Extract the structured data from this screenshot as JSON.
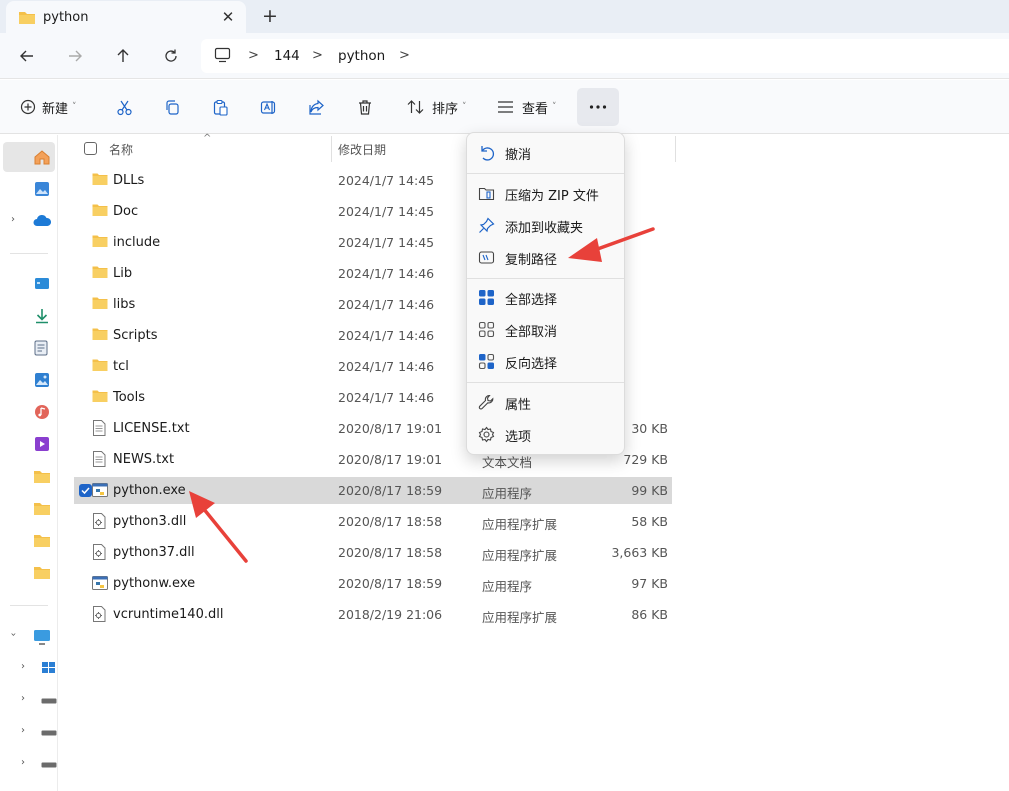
{
  "tab": {
    "title": "python"
  },
  "breadcrumb": [
    "144",
    "python"
  ],
  "toolbar": {
    "new_label": "新建",
    "sort_label": "排序",
    "view_label": "查看"
  },
  "columns": {
    "name": "名称",
    "modified": "修改日期"
  },
  "files": [
    {
      "name": "DLLs",
      "modified": "2024/1/7 14:45",
      "type": "",
      "size": "",
      "icon": "folder-icon",
      "selected": false
    },
    {
      "name": "Doc",
      "modified": "2024/1/7 14:45",
      "type": "",
      "size": "",
      "icon": "folder-icon",
      "selected": false
    },
    {
      "name": "include",
      "modified": "2024/1/7 14:45",
      "type": "",
      "size": "",
      "icon": "folder-icon",
      "selected": false
    },
    {
      "name": "Lib",
      "modified": "2024/1/7 14:46",
      "type": "",
      "size": "",
      "icon": "folder-icon",
      "selected": false
    },
    {
      "name": "libs",
      "modified": "2024/1/7 14:46",
      "type": "",
      "size": "",
      "icon": "folder-icon",
      "selected": false
    },
    {
      "name": "Scripts",
      "modified": "2024/1/7 14:46",
      "type": "",
      "size": "",
      "icon": "folder-icon",
      "selected": false
    },
    {
      "name": "tcl",
      "modified": "2024/1/7 14:46",
      "type": "",
      "size": "",
      "icon": "folder-icon",
      "selected": false
    },
    {
      "name": "Tools",
      "modified": "2024/1/7 14:46",
      "type": "",
      "size": "",
      "icon": "folder-icon",
      "selected": false
    },
    {
      "name": "LICENSE.txt",
      "modified": "2020/8/17 19:01",
      "type": "",
      "size": "30 KB",
      "icon": "text-file-icon",
      "selected": false
    },
    {
      "name": "NEWS.txt",
      "modified": "2020/8/17 19:01",
      "type": "文本文档",
      "size": "729 KB",
      "icon": "text-file-icon",
      "selected": false
    },
    {
      "name": "python.exe",
      "modified": "2020/8/17 18:59",
      "type": "应用程序",
      "size": "99 KB",
      "icon": "python-exe-icon",
      "selected": true
    },
    {
      "name": "python3.dll",
      "modified": "2020/8/17 18:58",
      "type": "应用程序扩展",
      "size": "58 KB",
      "icon": "dll-file-icon",
      "selected": false
    },
    {
      "name": "python37.dll",
      "modified": "2020/8/17 18:58",
      "type": "应用程序扩展",
      "size": "3,663 KB",
      "icon": "dll-file-icon",
      "selected": false
    },
    {
      "name": "pythonw.exe",
      "modified": "2020/8/17 18:59",
      "type": "应用程序",
      "size": "97 KB",
      "icon": "python-exe-icon",
      "selected": false
    },
    {
      "name": "vcruntime140.dll",
      "modified": "2018/2/19 21:06",
      "type": "应用程序扩展",
      "size": "86 KB",
      "icon": "dll-file-icon",
      "selected": false
    }
  ],
  "context_menu": {
    "items": [
      {
        "label": "撤消",
        "icon": "undo-icon"
      },
      {
        "label": "压缩为 ZIP 文件",
        "icon": "zip-icon"
      },
      {
        "label": "添加到收藏夹",
        "icon": "pin-icon"
      },
      {
        "label": "复制路径",
        "icon": "copy-path-icon"
      },
      {
        "label": "全部选择",
        "icon": "select-all-icon"
      },
      {
        "label": "全部取消",
        "icon": "select-none-icon"
      },
      {
        "label": "反向选择",
        "icon": "invert-selection-icon"
      },
      {
        "label": "属性",
        "icon": "properties-icon"
      },
      {
        "label": "选项",
        "icon": "options-icon"
      }
    ]
  },
  "colors": {
    "accent": "#1e64c8",
    "folder": "#f4c04a",
    "annotation_arrow": "#e8413a",
    "selection": "#d9d9d9"
  }
}
